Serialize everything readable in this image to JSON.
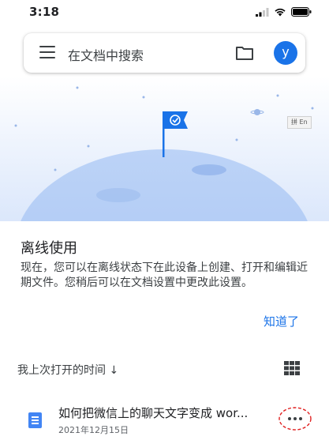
{
  "status_bar": {
    "time": "3:18"
  },
  "search": {
    "placeholder": "在文档中搜索",
    "avatar_letter": "y"
  },
  "banner": {
    "ime_hint": "拼 En"
  },
  "offline": {
    "title": "离线使用",
    "description": "现在，您可以在离线状态下在此设备上创建、打开和编辑近期文件。您稍后可以在文档设置中更改此设置。",
    "got_it": "知道了"
  },
  "list": {
    "sort_label": "我上次打开的时间 ↓"
  },
  "files": [
    {
      "name": "如何把微信上的聊天文字变成 wor...",
      "date": "2021年12月15日"
    }
  ],
  "colors": {
    "accent": "#1a73e8",
    "doc_icon": "#4285f4",
    "annotation": "#e02020"
  },
  "icons": [
    "signal-icon",
    "wifi-icon",
    "battery-icon",
    "menu-icon",
    "folder-icon",
    "grid-view-icon",
    "doc-icon",
    "more-icon"
  ]
}
